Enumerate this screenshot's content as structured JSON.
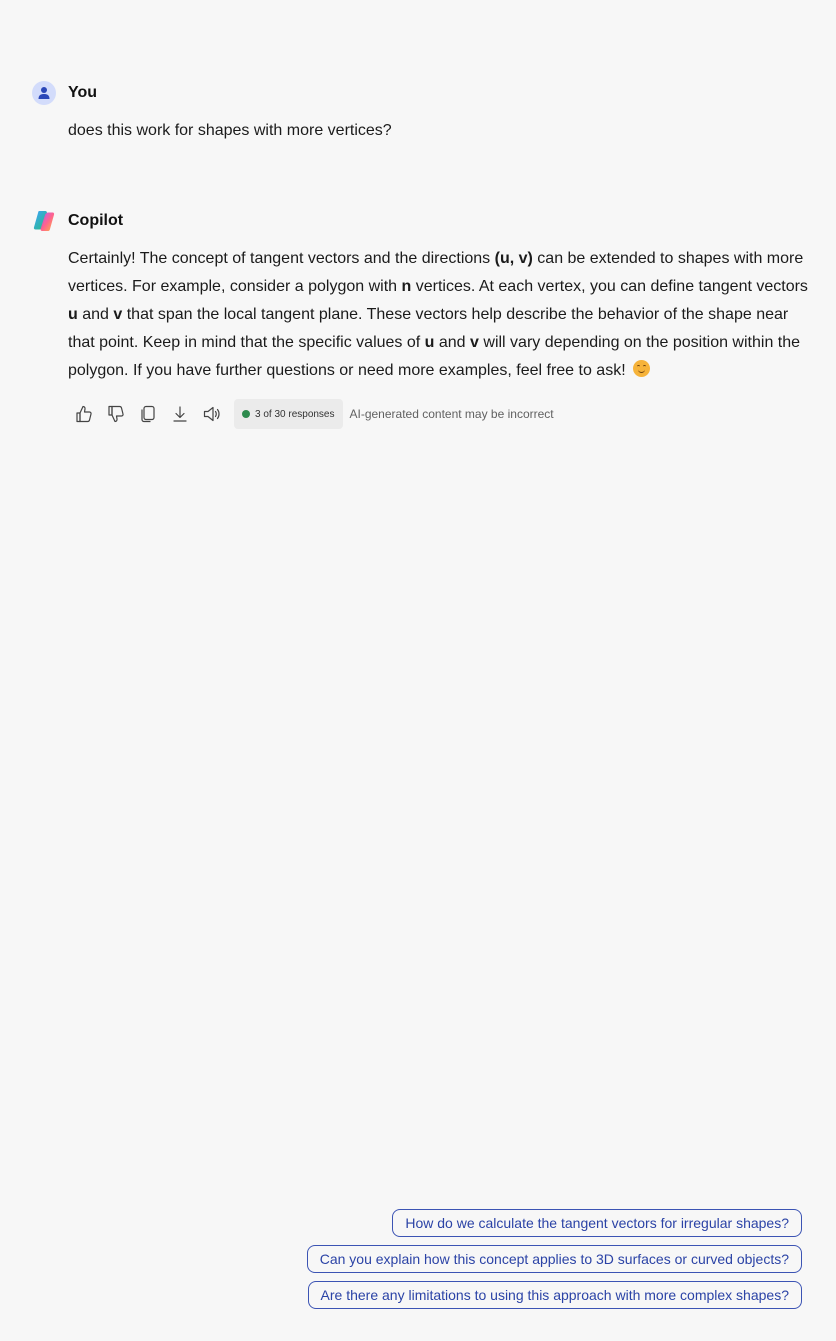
{
  "user_message": {
    "sender": "You",
    "text": "does this work for shapes with more vertices?"
  },
  "copilot_message": {
    "sender": "Copilot",
    "paragraph": [
      {
        "t": "Certainly! The concept of tangent vectors and the directions "
      },
      {
        "t": "(u, v)",
        "b": true
      },
      {
        "t": " can be extended to shapes with more vertices. For example, consider a polygon with "
      },
      {
        "t": "n",
        "b": true
      },
      {
        "t": " vertices. At each vertex, you can define tangent vectors "
      },
      {
        "t": "u",
        "b": true
      },
      {
        "t": " and "
      },
      {
        "t": "v",
        "b": true
      },
      {
        "t": " that span the local tangent plane. These vectors help describe the behavior of the shape near that point. Keep in mind that the specific values of "
      },
      {
        "t": "u",
        "b": true
      },
      {
        "t": " and "
      },
      {
        "t": "v",
        "b": true
      },
      {
        "t": " will vary depending on the position within the polygon. If you have further questions or need more examples, feel free to ask! "
      }
    ],
    "emoji": "smiling-face-emoji"
  },
  "actions": {
    "icons": [
      "thumbs-up-icon",
      "thumbs-down-icon",
      "copy-icon",
      "download-icon",
      "read-aloud-icon"
    ],
    "responses_label": "3 of 30 responses",
    "responses_dot_color": "#2e8b4e",
    "disclaimer": "AI-generated content may be incorrect"
  },
  "suggestions": [
    "How do we calculate the tangent vectors for irregular shapes?",
    "Can you explain how this concept applies to 3D surfaces or curved objects?",
    "Are there any limitations to using this approach with more complex shapes?"
  ],
  "colors": {
    "background": "#f7f7f7",
    "suggestion_border": "#3c54b4",
    "suggestion_text": "#2b43a6",
    "user_avatar_bg": "#d3dcfb"
  }
}
